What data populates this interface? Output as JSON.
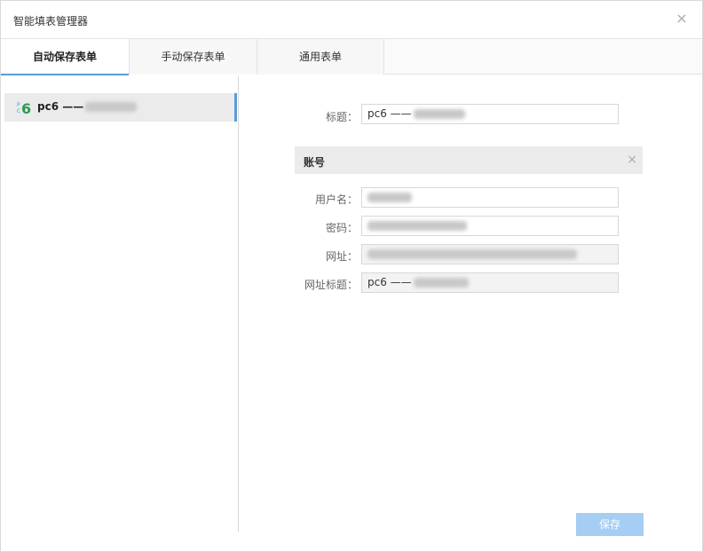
{
  "dialog": {
    "title": "智能填表管理器",
    "close_icon": "close-icon"
  },
  "tabs": [
    {
      "label": "自动保存表单",
      "active": true
    },
    {
      "label": "手动保存表单",
      "active": false
    },
    {
      "label": "通用表单",
      "active": false
    }
  ],
  "sidebar": {
    "items": [
      {
        "icon": "pc6-logo-icon",
        "label": "pc6 ——",
        "selected": true
      }
    ]
  },
  "form": {
    "title_label": "标题：",
    "title_value": "pc6 ——",
    "account_section": {
      "title": "账号",
      "close_icon": "close-icon"
    },
    "username_label": "用户名：",
    "password_label": "密码：",
    "url_label": "网址：",
    "url_title_label": "网址标题：",
    "url_title_value": "pc6 ——"
  },
  "save_label": "保存",
  "colors": {
    "accent": "#5b9bd5",
    "save_button": "#a6cdf3",
    "section_bg": "#ebebeb"
  }
}
